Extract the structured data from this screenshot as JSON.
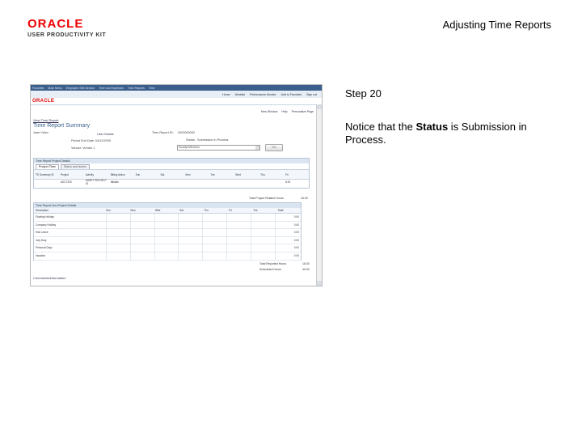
{
  "header": {
    "logo_brand": "ORACLE",
    "logo_product": "USER PRODUCTIVITY KIT",
    "doc_title": "Adjusting Time Reports"
  },
  "step": {
    "label": "Step 20",
    "note_before": "Notice that the ",
    "note_bold": "Status",
    "note_after": " is Submission in Process."
  },
  "screenshot": {
    "nav_items": [
      "Favorites",
      "Main Menu",
      "Employee Self-Service",
      "Time and Expenses",
      "Time Reports",
      "Time"
    ],
    "top_links": [
      "Home",
      "Worklist",
      "Performance Monitor",
      "Add to Favorites",
      "Sign out"
    ],
    "brand": "ORACLE",
    "right_links": [
      "New Window",
      "Help",
      "Personalize Page"
    ],
    "breadcrumb": "View Time Report",
    "page_title": "Time Report Summary",
    "user_label": "Jean Victor",
    "user_details": "User Details",
    "period_label": "Period End Date: 04/12/2009",
    "vendor_label": "Vendor: Vendor 1",
    "report_id_label": "Time Report ID:",
    "report_id": "0000000052",
    "status_label": "Status:",
    "status_value": "Submission in Process",
    "action_select": "Modify/Withdraw",
    "go_label": "GO",
    "grid1_title": "Time Report Project Details",
    "grid1_tabs": [
      "Project Time",
      "Status and Issues"
    ],
    "grid1_cols": [
      "TE Summary ID",
      "Project",
      "Activity",
      "Billing Action",
      "Sun",
      "Sat",
      "Mon",
      "Tue",
      "Wed",
      "Thu",
      "Fri"
    ],
    "grid1_row": [
      "",
      "ASCT200",
      "ASSET PROJECT 01",
      "Billable",
      "",
      "",
      "",
      "",
      "",
      "",
      "8.00"
    ],
    "total_project_hours_label": "Total Project Related Hours",
    "total_project_hours": "16.00",
    "grid2_title": "Time Report Non-Project Details",
    "grid2_cols": [
      "Description",
      "Sun",
      "Mon",
      "Wed",
      "Sat",
      "Thu",
      "Fri",
      "Tue",
      "Total"
    ],
    "grid2_rows": [
      {
        "desc": "Floating Holiday",
        "total": "0.00"
      },
      {
        "desc": "Company Holiday",
        "total": "0.00"
      },
      {
        "desc": "Sick Leave",
        "total": "0.00"
      },
      {
        "desc": "Jury Duty",
        "total": "0.00"
      },
      {
        "desc": "Personal Days",
        "total": "0.00"
      },
      {
        "desc": "Vacation",
        "total": "0.00"
      }
    ],
    "total_reported_label": "Total Reported Hours",
    "total_reported": "16.00",
    "scheduled_label": "Scheduled Hours",
    "scheduled": "40.00",
    "footer_link": "Comments/Information"
  }
}
